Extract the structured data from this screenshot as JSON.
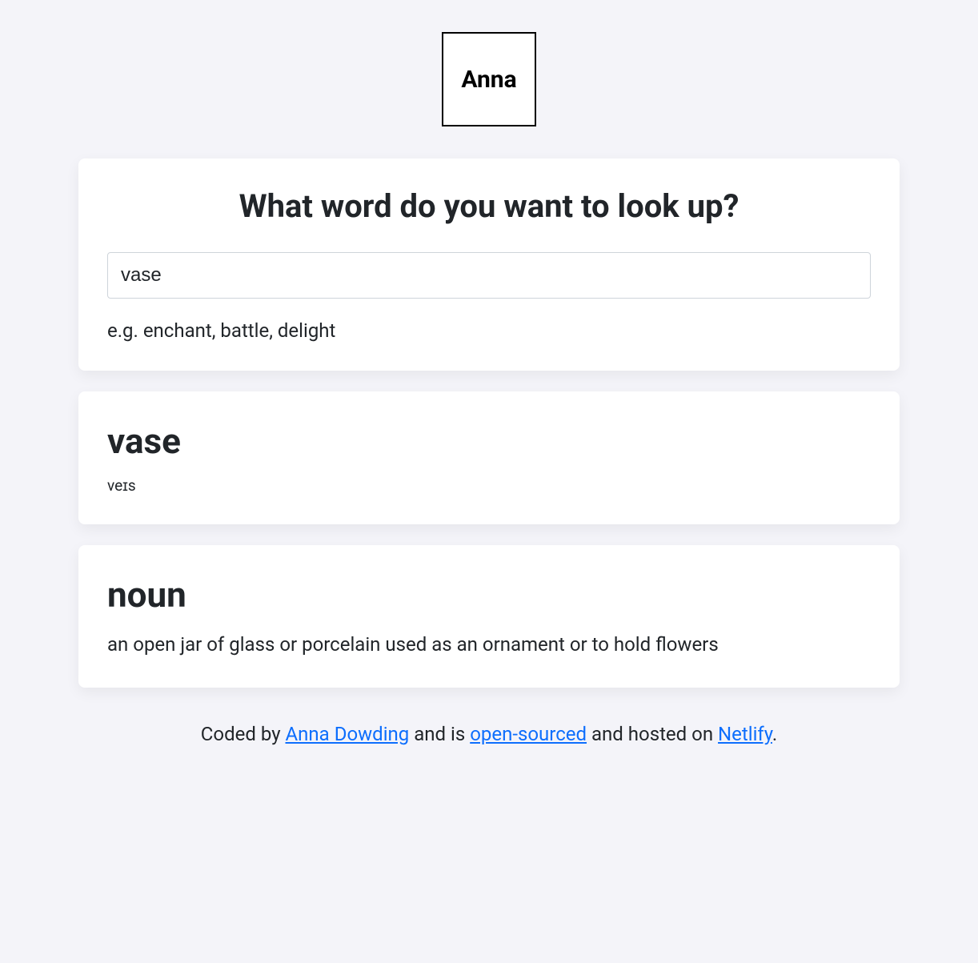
{
  "logo": {
    "text": "Anna"
  },
  "search": {
    "heading": "What word do you want to look up?",
    "value": "vase",
    "hint": "e.g. enchant, battle, delight"
  },
  "result": {
    "word": "vase",
    "phonetic": "veɪs"
  },
  "meaning": {
    "partOfSpeech": "noun",
    "definition": "an open jar of glass or porcelain used as an ornament or to hold flowers"
  },
  "footer": {
    "prefix": "Coded by ",
    "author": "Anna Dowding",
    "mid1": " and is ",
    "openSource": "open-sourced",
    "mid2": " and hosted on ",
    "host": "Netlify",
    "suffix": "."
  }
}
